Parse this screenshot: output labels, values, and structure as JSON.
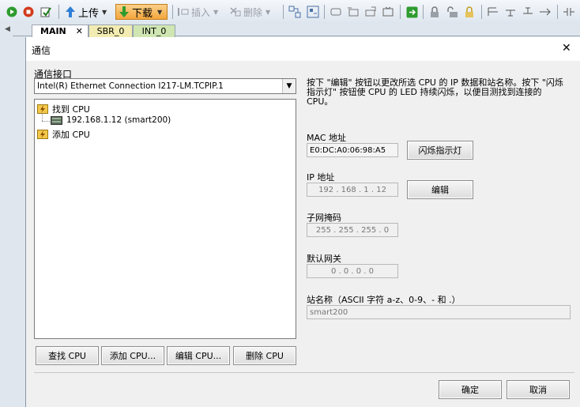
{
  "toolbar": {
    "upload_label": "上传",
    "download_label": "下载",
    "insert_label": "插入",
    "delete_label": "删除"
  },
  "tabs": [
    {
      "label": "MAIN"
    },
    {
      "label": "SBR_0"
    },
    {
      "label": "INT_0"
    }
  ],
  "dialog": {
    "title": "通信",
    "close_glyph": "✕",
    "interface_label": "通信接口",
    "interface_value": "Intel(R) Ethernet Connection I217-LM.TCPIP.1",
    "tree": {
      "found_label": "找到 CPU",
      "device_label": "192.168.1.12 (smart200)",
      "add_label": "添加 CPU"
    },
    "info_text": "按下 \"编辑\" 按钮以更改所选 CPU 的 IP 数据和站名称。按下 \"闪烁指示灯\" 按钮使 CPU 的 LED 持续闪烁，以便目测找到连接的 CPU。",
    "mac_label": "MAC 地址",
    "mac_value": "E0:DC:A0:06:98:A5",
    "blink_button": "闪烁指示灯",
    "ip_label": "IP 地址",
    "ip_value": "192 . 168 .  1  .  12",
    "edit_button": "编辑",
    "subnet_label": "子网掩码",
    "subnet_value": "255 . 255 . 255 .  0",
    "gateway_label": "默认网关",
    "gateway_value": "0  .  0  .  0  .  0",
    "station_label": "站名称（ASCII 字符 a-z、0-9、- 和 .）",
    "station_value": "smart200",
    "find_cpu_button": "查找 CPU",
    "add_cpu_button": "添加 CPU...",
    "edit_cpu_button": "编辑 CPU...",
    "delete_cpu_button": "删除 CPU",
    "ok_button": "确定",
    "cancel_button": "取消"
  }
}
